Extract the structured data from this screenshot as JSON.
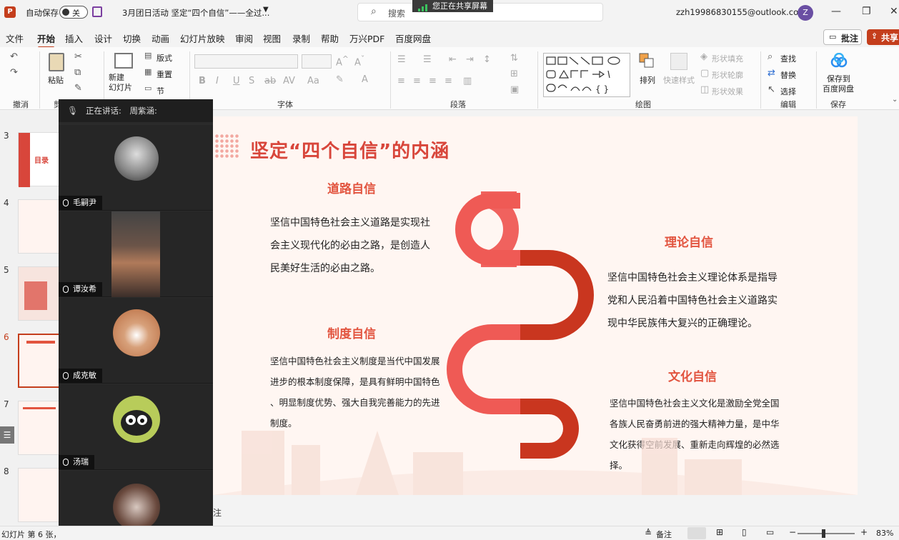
{
  "titlebar": {
    "autosave_label": "自动保存",
    "autosave_state": "关",
    "doc_title": "3月团日活动 坚定“四个自信”——全过...",
    "search_placeholder": "搜索",
    "sharing_banner": "您正在共享屏幕",
    "account": "zzh19986830155@outlook.com",
    "avatar_letter": "Z"
  },
  "tabs": [
    "文件",
    "开始",
    "插入",
    "设计",
    "切换",
    "动画",
    "幻灯片放映",
    "审阅",
    "视图",
    "录制",
    "帮助",
    "万兴PDF",
    "百度网盘"
  ],
  "active_tab": "开始",
  "actions": {
    "comment": "批注",
    "share": "共享"
  },
  "ribbon": {
    "groups": [
      "撤消",
      "剪",
      "字体",
      "段落",
      "绘图",
      "编辑",
      "保存"
    ],
    "paste": "粘贴",
    "new_slide": "新建\n幻灯片",
    "layout": "版式",
    "reset": "重置",
    "section": "节",
    "arrange": "排列",
    "quick_styles": "快速样式",
    "shape_fill": "形状填充",
    "shape_outline": "形状轮廓",
    "shape_effects": "形状效果",
    "find": "查找",
    "replace": "替换",
    "select": "选择",
    "save_to": "保存到",
    "baidu": "百度网盘"
  },
  "thumbnails": {
    "numbers": [
      "3",
      "4",
      "5",
      "6",
      "7",
      "8"
    ],
    "selected": "6",
    "thumb3_text": "目录"
  },
  "meeting": {
    "speaking_label": "正在讲话:",
    "speaker": "周紫涵:",
    "participants": [
      "毛嗣尹",
      "谭汝希",
      "成克敏",
      "汤瑞",
      ""
    ]
  },
  "slide": {
    "title": "坚定“四个自信”的内涵",
    "sections": [
      {
        "heading": "道路自信",
        "lines": [
          "坚信中国特色社会主义道路是实现社",
          "会主义现代化的必由之路，是创造人",
          "民美好生活的必由之路。"
        ]
      },
      {
        "heading": "理论自信",
        "lines": [
          "坚信中国特色社会主义理论体系是指导",
          "党和人民沿着中国特色社会主义道路实",
          "现中华民族伟大复兴的正确理论。"
        ]
      },
      {
        "heading": "制度自信",
        "lines": [
          "坚信中国特色社会主义制度是当代中国发展",
          "进步的根本制度保障，是具有鲜明中国特色",
          "、明显制度优势、强大自我完善能力的先进",
          "制度。"
        ]
      },
      {
        "heading": "文化自信",
        "lines": [
          "坚信中国特色社会主义文化是激励全党全国",
          "各族人民奋勇前进的强大精神力量，是中华",
          "文化获得空前发展、重新走向辉煌的必然选",
          "择。"
        ]
      }
    ],
    "colors": {
      "title": "#d8463b",
      "arc_light": "#ef5a55",
      "arc_dark": "#c9361f"
    }
  },
  "notes_stub": "注",
  "status": {
    "slide_info": "幻灯片 第 6 张，",
    "notes": "备注",
    "zoom": "83%"
  }
}
